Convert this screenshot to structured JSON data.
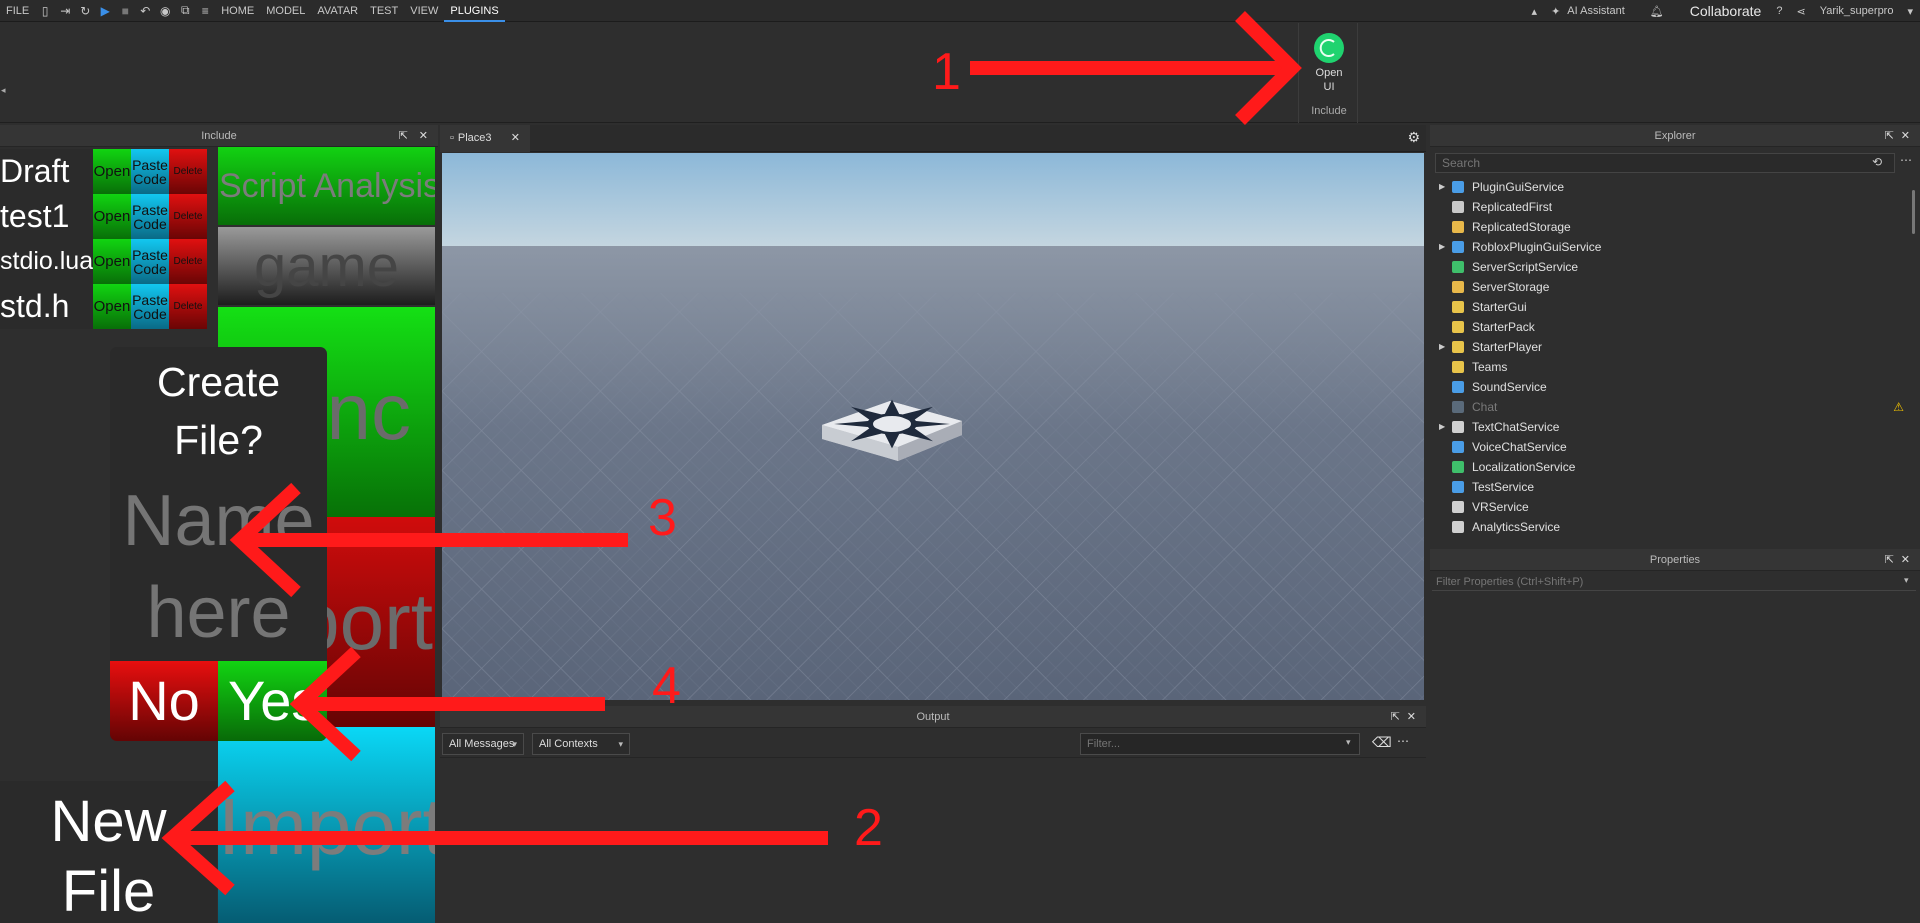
{
  "menubar": {
    "file_label": "FILE",
    "tabs": [
      "HOME",
      "MODEL",
      "AVATAR",
      "TEST",
      "VIEW",
      "PLUGINS"
    ],
    "active_tab": "PLUGINS",
    "ai_assistant_label": "AI Assistant",
    "collaborate_label": "Collaborate",
    "username": "Yarik_superpro"
  },
  "ribbon": {
    "open_ui_label": "Open UI",
    "group_label": "Include"
  },
  "include_panel": {
    "title": "Include",
    "files": [
      {
        "name": "Draft",
        "open": "Open",
        "paste": "Paste Code",
        "delete": "Delete"
      },
      {
        "name": "test1",
        "open": "Open",
        "paste": "Paste Code",
        "delete": "Delete"
      },
      {
        "name": "stdio.lua",
        "open": "Open",
        "paste": "Paste Code",
        "delete": "Delete"
      },
      {
        "name": "std.h",
        "open": "Open",
        "paste": "Paste Code",
        "delete": "Delete"
      }
    ],
    "script_analysis_label": "Script Analysis",
    "game_label": "game",
    "sync_label": "nc",
    "export_label": "port",
    "import_label": "Import",
    "dialog": {
      "title": "Create File?",
      "name_placeholder": "Name here",
      "no_label": "No",
      "yes_label": "Yes"
    },
    "new_file_label": "New File"
  },
  "viewport": {
    "tab_label": "Place3"
  },
  "output": {
    "title": "Output",
    "messages_filter": "All Messages",
    "contexts_filter": "All Contexts",
    "filter_placeholder": "Filter..."
  },
  "explorer": {
    "title": "Explorer",
    "search_placeholder": "Search",
    "items": [
      {
        "label": "PluginGuiService",
        "expandable": true,
        "color": "#4a9de6",
        "dim": false,
        "warning": false
      },
      {
        "label": "ReplicatedFirst",
        "expandable": false,
        "color": "#c9c9c9",
        "dim": false,
        "warning": false
      },
      {
        "label": "ReplicatedStorage",
        "expandable": false,
        "color": "#e8b84a",
        "dim": false,
        "warning": false
      },
      {
        "label": "RobloxPluginGuiService",
        "expandable": true,
        "color": "#4a9de6",
        "dim": false,
        "warning": false
      },
      {
        "label": "ServerScriptService",
        "expandable": false,
        "color": "#3fbf6b",
        "dim": false,
        "warning": false
      },
      {
        "label": "ServerStorage",
        "expandable": false,
        "color": "#e8b84a",
        "dim": false,
        "warning": false
      },
      {
        "label": "StarterGui",
        "expandable": false,
        "color": "#e8c44a",
        "dim": false,
        "warning": false
      },
      {
        "label": "StarterPack",
        "expandable": false,
        "color": "#e8c44a",
        "dim": false,
        "warning": false
      },
      {
        "label": "StarterPlayer",
        "expandable": true,
        "color": "#e8c44a",
        "dim": false,
        "warning": false
      },
      {
        "label": "Teams",
        "expandable": false,
        "color": "#e8c44a",
        "dim": false,
        "warning": false
      },
      {
        "label": "SoundService",
        "expandable": false,
        "color": "#4a9de6",
        "dim": false,
        "warning": false
      },
      {
        "label": "Chat",
        "expandable": false,
        "color": "#5a6a7a",
        "dim": true,
        "warning": true
      },
      {
        "label": "TextChatService",
        "expandable": true,
        "color": "#d0d0d0",
        "dim": false,
        "warning": false
      },
      {
        "label": "VoiceChatService",
        "expandable": false,
        "color": "#4a9de6",
        "dim": false,
        "warning": false
      },
      {
        "label": "LocalizationService",
        "expandable": false,
        "color": "#3fbf6b",
        "dim": false,
        "warning": false
      },
      {
        "label": "TestService",
        "expandable": false,
        "color": "#4a9de6",
        "dim": false,
        "warning": false
      },
      {
        "label": "VRService",
        "expandable": false,
        "color": "#d0d0d0",
        "dim": false,
        "warning": false
      },
      {
        "label": "AnalyticsService",
        "expandable": false,
        "color": "#d0d0d0",
        "dim": false,
        "warning": false
      }
    ]
  },
  "properties": {
    "title": "Properties",
    "filter_placeholder": "Filter Properties (Ctrl+Shift+P)"
  },
  "annotations": {
    "labels": [
      "1",
      "2",
      "3",
      "4"
    ],
    "arrow_color": "#ff1a1a"
  },
  "colors": {
    "accent": "#3a8fe8",
    "open_ui": "#1fd36f",
    "green_button": "#12d212",
    "red_button": "#e01010",
    "cyan_button": "#0ad8f6"
  }
}
